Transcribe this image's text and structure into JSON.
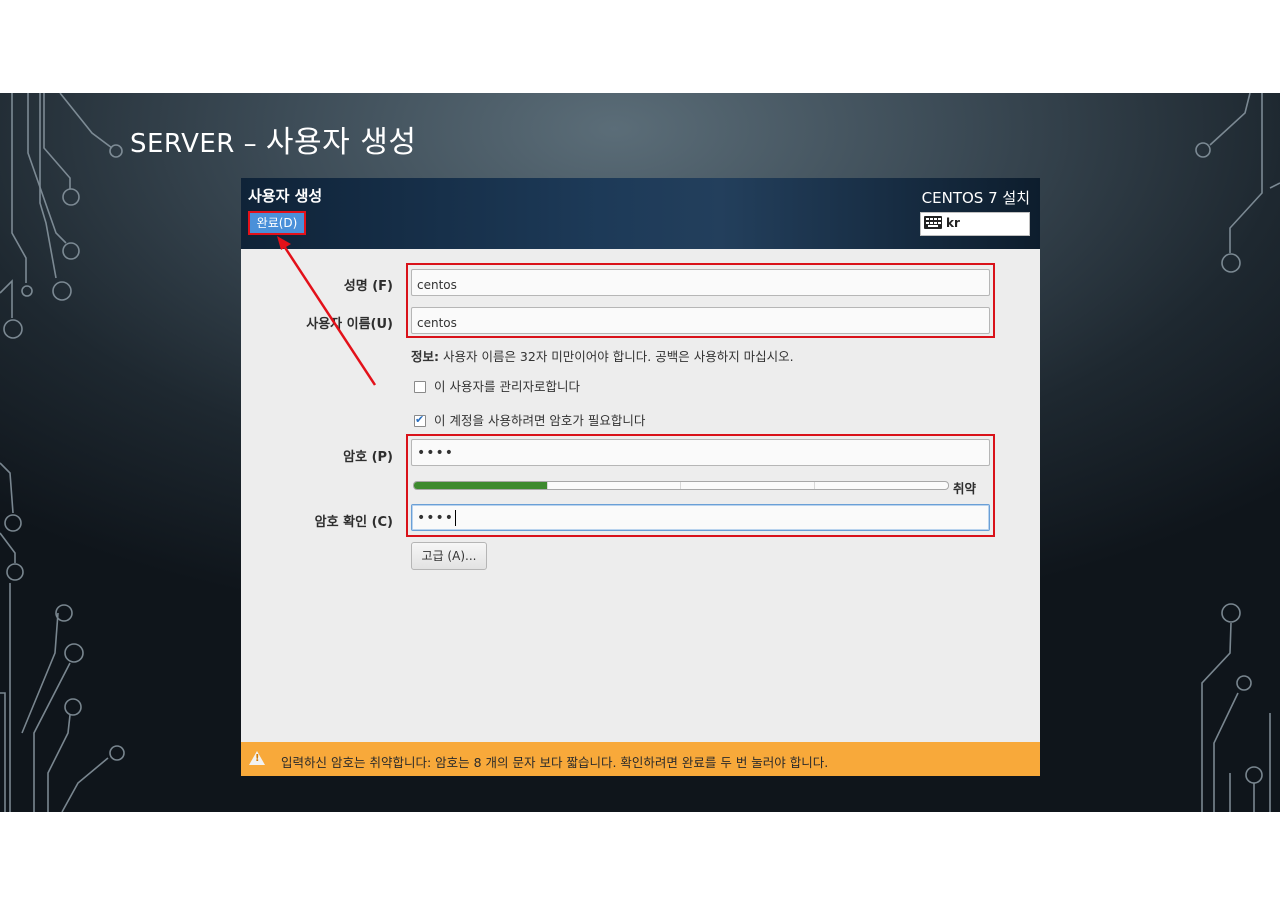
{
  "slide": {
    "title_latin": "SERVER – ",
    "title_korean": "사용자 생성"
  },
  "installer": {
    "page_title": "사용자 생성",
    "done_button": "완료(D)",
    "product_title": "CENTOS 7 설치",
    "keyboard_layout": "kr",
    "form": {
      "fullname_label": "성명 (F)",
      "fullname_value": "centos",
      "username_label": "사용자 이름(U)",
      "username_value": "centos",
      "info_prefix": "정보:",
      "info_text": " 사용자 이름은 32자 미만이어야 합니다. 공백은 사용하지 마십시오.",
      "admin_checkbox": {
        "label": "이 사용자를 관리자로합니다",
        "checked": false
      },
      "require_pw_checkbox": {
        "label": "이 계정을 사용하려면 암호가 필요합니다",
        "checked": true
      },
      "password_label": "암호 (P)",
      "password_value": "••••",
      "strength_fraction": 0.25,
      "strength_label": "취약",
      "confirm_label": "암호 확인 (C)",
      "confirm_value": "••••",
      "advanced_button": "고급 (A)..."
    },
    "warning": {
      "icon": "warning-icon",
      "text": "입력하신 암호는 취약합니다: 암호는 8 개의 문자 보다 짧습니다. 확인하려면 완료를 두 번 눌러야 합니다."
    }
  },
  "colors": {
    "annotation_red": "#d9121a",
    "header_blue": "#1d3a58",
    "warning_orange": "#f8a93a",
    "strength_green": "#3d8a2e"
  }
}
